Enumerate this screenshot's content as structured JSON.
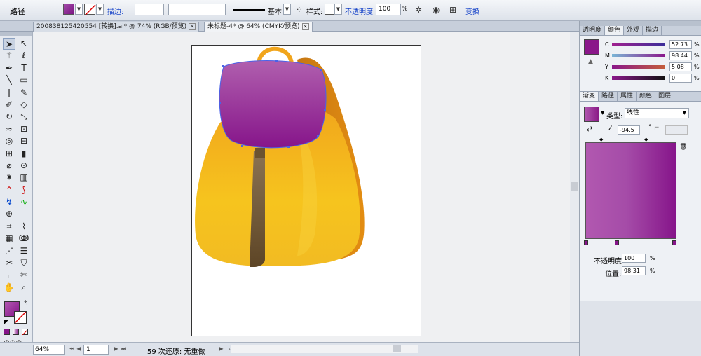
{
  "control_bar": {
    "object_type": "路径",
    "stroke_label": "描边:",
    "stroke_profile": "基本",
    "style_label": "样式:",
    "opacity_label": "不透明度",
    "opacity_value": "100",
    "opacity_unit": "%",
    "transform_link": "变换"
  },
  "tabs": [
    {
      "label": "200838125420554 [转换].ai* @ 74% (RGB/预览)",
      "active": false
    },
    {
      "label": "未标题-4* @ 64% (CMYK/预览)",
      "active": true
    }
  ],
  "status_bar": {
    "zoom": "64%",
    "page": "1",
    "status_text": "59 次还原: 无重做"
  },
  "color_panel": {
    "tabs": [
      "透明度",
      "颜色",
      "外观",
      "描边"
    ],
    "active_tab": "颜色",
    "swatch_color": "#8a178a",
    "channels": [
      {
        "label": "C",
        "value": "52.73",
        "unit": "%"
      },
      {
        "label": "M",
        "value": "98.44",
        "unit": "%"
      },
      {
        "label": "Y",
        "value": "5.08",
        "unit": "%"
      },
      {
        "label": "K",
        "value": "0",
        "unit": "%"
      }
    ]
  },
  "gradient_panel": {
    "tabs": [
      "渐变",
      "路径",
      "属性",
      "颜色",
      "图层"
    ],
    "active_tab": "渐变",
    "type_label": "类型:",
    "type_value": "线性",
    "angle_value": "-94.5",
    "angle_unit": "°",
    "opacity_label": "不透明度:",
    "opacity_value": "100",
    "opacity_unit": "%",
    "location_label": "位置:",
    "location_value": "98.31",
    "location_unit": "%"
  },
  "colors": {
    "fill_start": "#b158b0",
    "fill_end": "#86158a",
    "backpack_yellow": "#f4b51c",
    "backpack_orange": "#e08a13",
    "strap_brown": "#6b5330"
  }
}
